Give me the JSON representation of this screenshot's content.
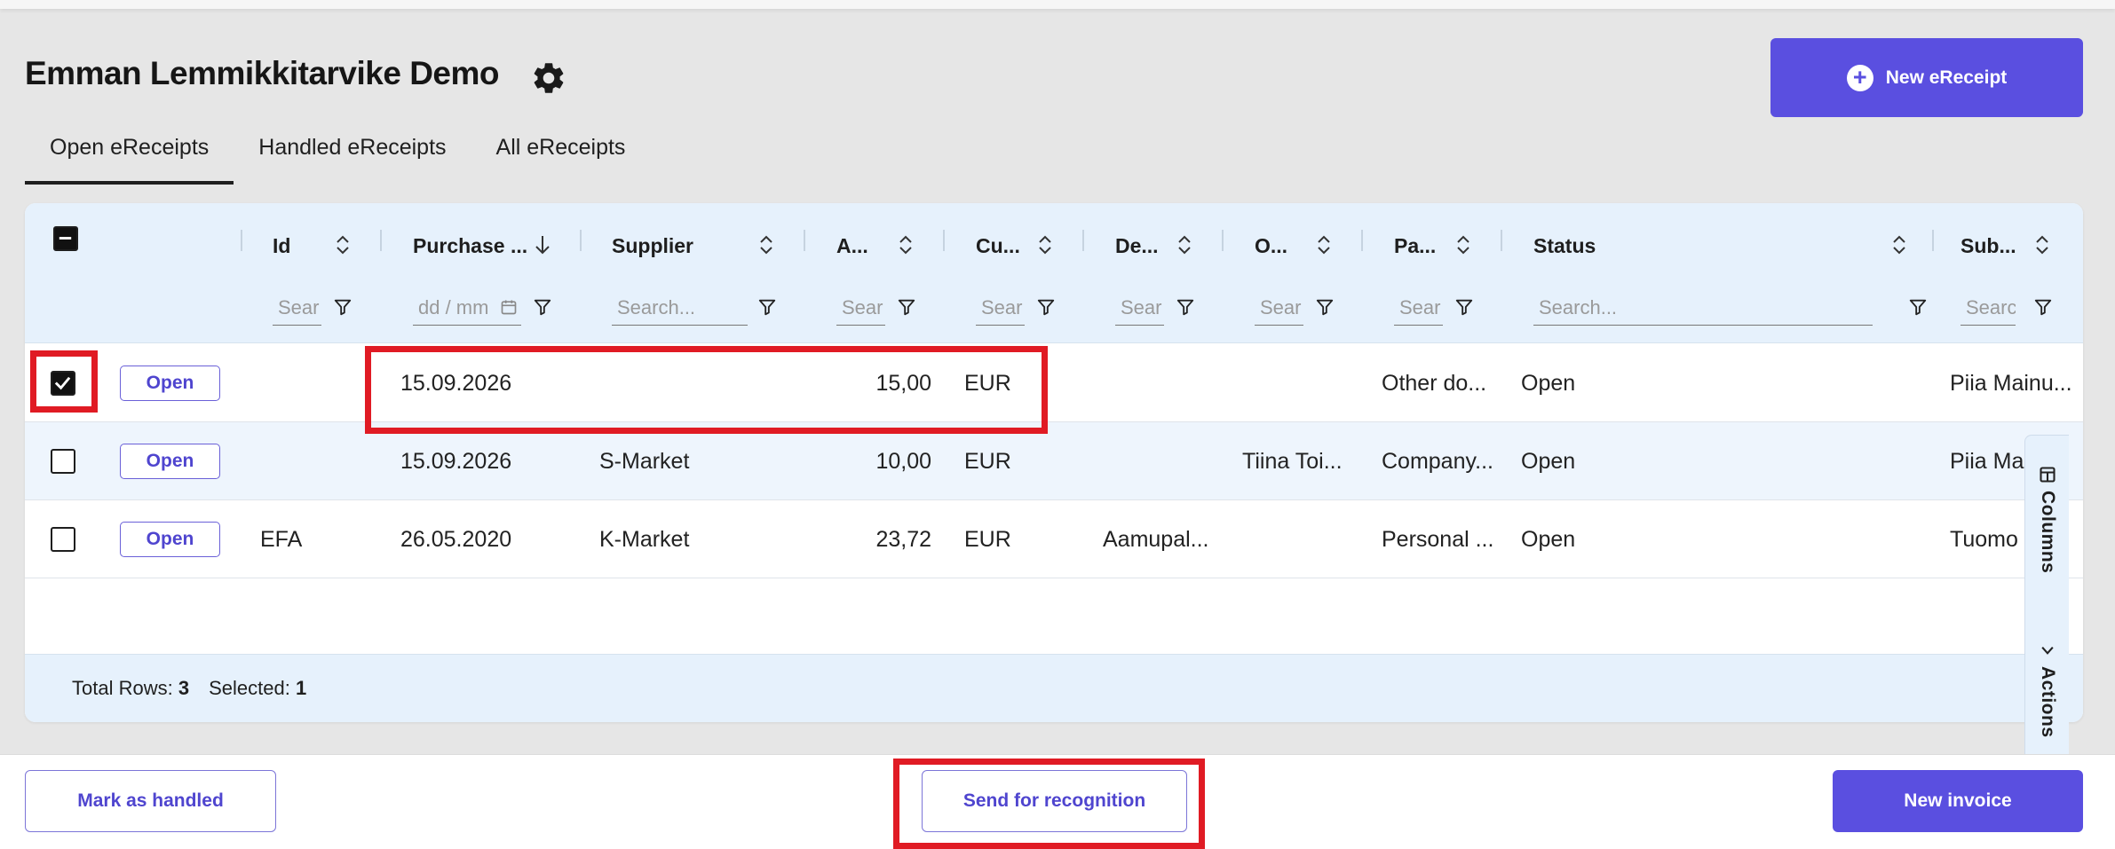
{
  "header": {
    "title": "Emman Lemmikkitarvike Demo",
    "settings_icon": "gear-icon",
    "new_ereceipt_label": "New eReceipt",
    "new_ereceipt_icon": "plus-circle-icon"
  },
  "tabs": [
    {
      "label": "Open eReceipts",
      "active": true
    },
    {
      "label": "Handled eReceipts",
      "active": false
    },
    {
      "label": "All eReceipts",
      "active": false
    }
  ],
  "table": {
    "columns": [
      {
        "key": "id",
        "label": "Id",
        "filter_placeholder": "Sear",
        "sort": "none"
      },
      {
        "key": "purchase_date",
        "label": "Purchase ...",
        "filter_placeholder": "dd / mm",
        "sort": "descending"
      },
      {
        "key": "supplier",
        "label": "Supplier",
        "filter_placeholder": "Search...",
        "sort": "none"
      },
      {
        "key": "amount",
        "label": "A...",
        "filter_placeholder": "Sear",
        "sort": "none"
      },
      {
        "key": "currency",
        "label": "Cu...",
        "filter_placeholder": "Sear",
        "sort": "none"
      },
      {
        "key": "description",
        "label": "De...",
        "filter_placeholder": "Sear",
        "sort": "none"
      },
      {
        "key": "owner",
        "label": "O...",
        "filter_placeholder": "Sear",
        "sort": "none"
      },
      {
        "key": "payment",
        "label": "Pa...",
        "filter_placeholder": "Sear",
        "sort": "none"
      },
      {
        "key": "status",
        "label": "Status",
        "filter_placeholder": "Search...",
        "sort": "none"
      },
      {
        "key": "submitter",
        "label": "Sub...",
        "filter_placeholder": "Searc",
        "sort": "none"
      }
    ],
    "rows": [
      {
        "selected": true,
        "open_label": "Open",
        "id": "",
        "purchase_date": "15.09.2026",
        "supplier": "",
        "amount": "15,00",
        "currency": "EUR",
        "description": "",
        "owner": "",
        "payment": "Other do...",
        "status": "Open",
        "submitter": "Piia Mainu..."
      },
      {
        "selected": false,
        "open_label": "Open",
        "id": "",
        "purchase_date": "15.09.2026",
        "supplier": "S-Market",
        "amount": "10,00",
        "currency": "EUR",
        "description": "",
        "owner": "Tiina Toi...",
        "payment": "Company...",
        "status": "Open",
        "submitter": "Piia Mai"
      },
      {
        "selected": false,
        "open_label": "Open",
        "id": "EFA",
        "purchase_date": "26.05.2020",
        "supplier": "K-Market",
        "amount": "23,72",
        "currency": "EUR",
        "description": "Aamupal...",
        "owner": "",
        "payment": "Personal ...",
        "status": "Open",
        "submitter": "Tuomo"
      }
    ],
    "footer": {
      "total_label": "Total Rows:",
      "total_value": "3",
      "selected_label": "Selected:",
      "selected_value": "1"
    },
    "side_panel": {
      "columns_label": "Columns",
      "columns_icon": "columns-icon",
      "actions_label": "Actions",
      "actions_icon": "chevron-icon"
    }
  },
  "actions": {
    "mark_handled": "Mark as handled",
    "send_recognition": "Send for recognition",
    "new_invoice": "New invoice"
  },
  "colors": {
    "accent": "#5a4fe0",
    "highlight": "#e01b24",
    "header_bg": "#e6f1fc"
  }
}
